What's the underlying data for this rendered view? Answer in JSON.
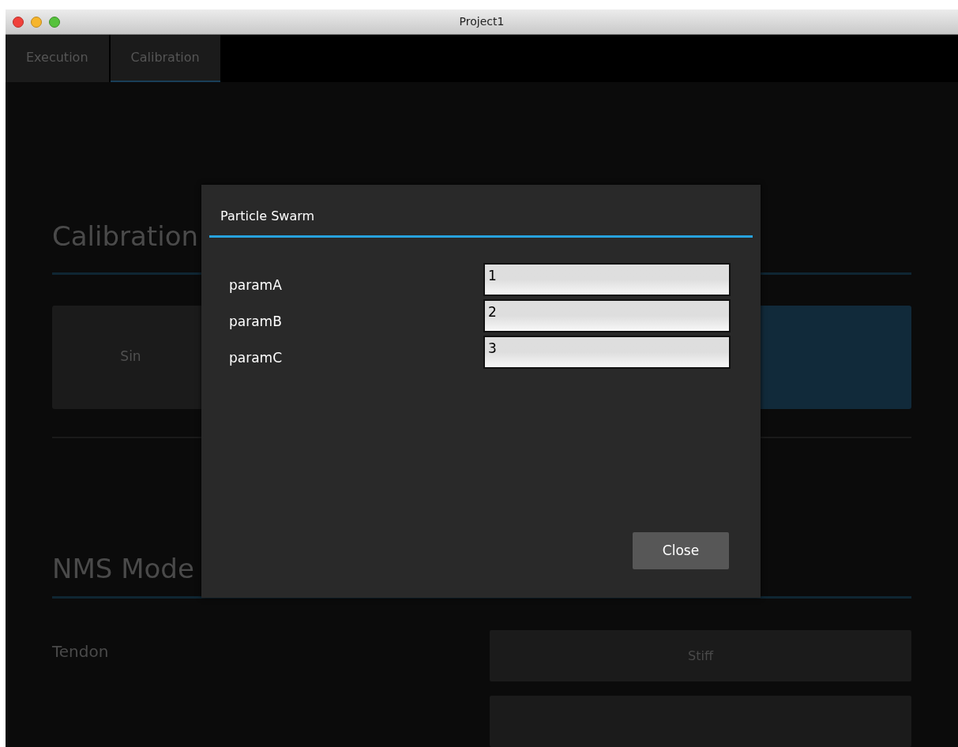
{
  "window": {
    "title": "Project1"
  },
  "tabs": [
    {
      "label": "Execution",
      "selected": false
    },
    {
      "label": "Calibration",
      "selected": true
    }
  ],
  "background": {
    "calibration_heading": "Calibration",
    "cards": [
      {
        "label": "Sin",
        "selected": false
      },
      {
        "selected": true
      }
    ],
    "nms_heading": "NMS Mode",
    "tendon_label": "Tendon",
    "tendon_options": [
      {
        "label": "Stiff"
      }
    ]
  },
  "dialog": {
    "title": "Particle Swarm",
    "params": [
      {
        "label": "paramA",
        "value": "1"
      },
      {
        "label": "paramB",
        "value": "2"
      },
      {
        "label": "paramC",
        "value": "3"
      }
    ],
    "close_button": "Close"
  }
}
